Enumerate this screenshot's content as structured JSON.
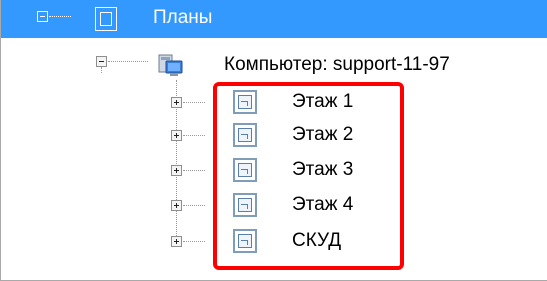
{
  "tree": {
    "root": {
      "label": "Планы",
      "expanded": true,
      "selected": true,
      "icon": "plans-folder-icon"
    },
    "computer": {
      "label": "Компьютер: support-11-97",
      "expanded": true,
      "icon": "computer-icon"
    },
    "plans": [
      {
        "label": "Этаж 1",
        "expanded": false,
        "icon": "floor-plan-icon"
      },
      {
        "label": "Этаж 2",
        "expanded": false,
        "icon": "floor-plan-icon"
      },
      {
        "label": "Этаж 3",
        "expanded": false,
        "icon": "floor-plan-icon"
      },
      {
        "label": "Этаж 4",
        "expanded": false,
        "icon": "floor-plan-icon"
      },
      {
        "label": "СКУД",
        "expanded": false,
        "icon": "floor-plan-icon"
      }
    ]
  },
  "colors": {
    "selection": "#3399ff",
    "highlight_border": "#ff0000"
  }
}
